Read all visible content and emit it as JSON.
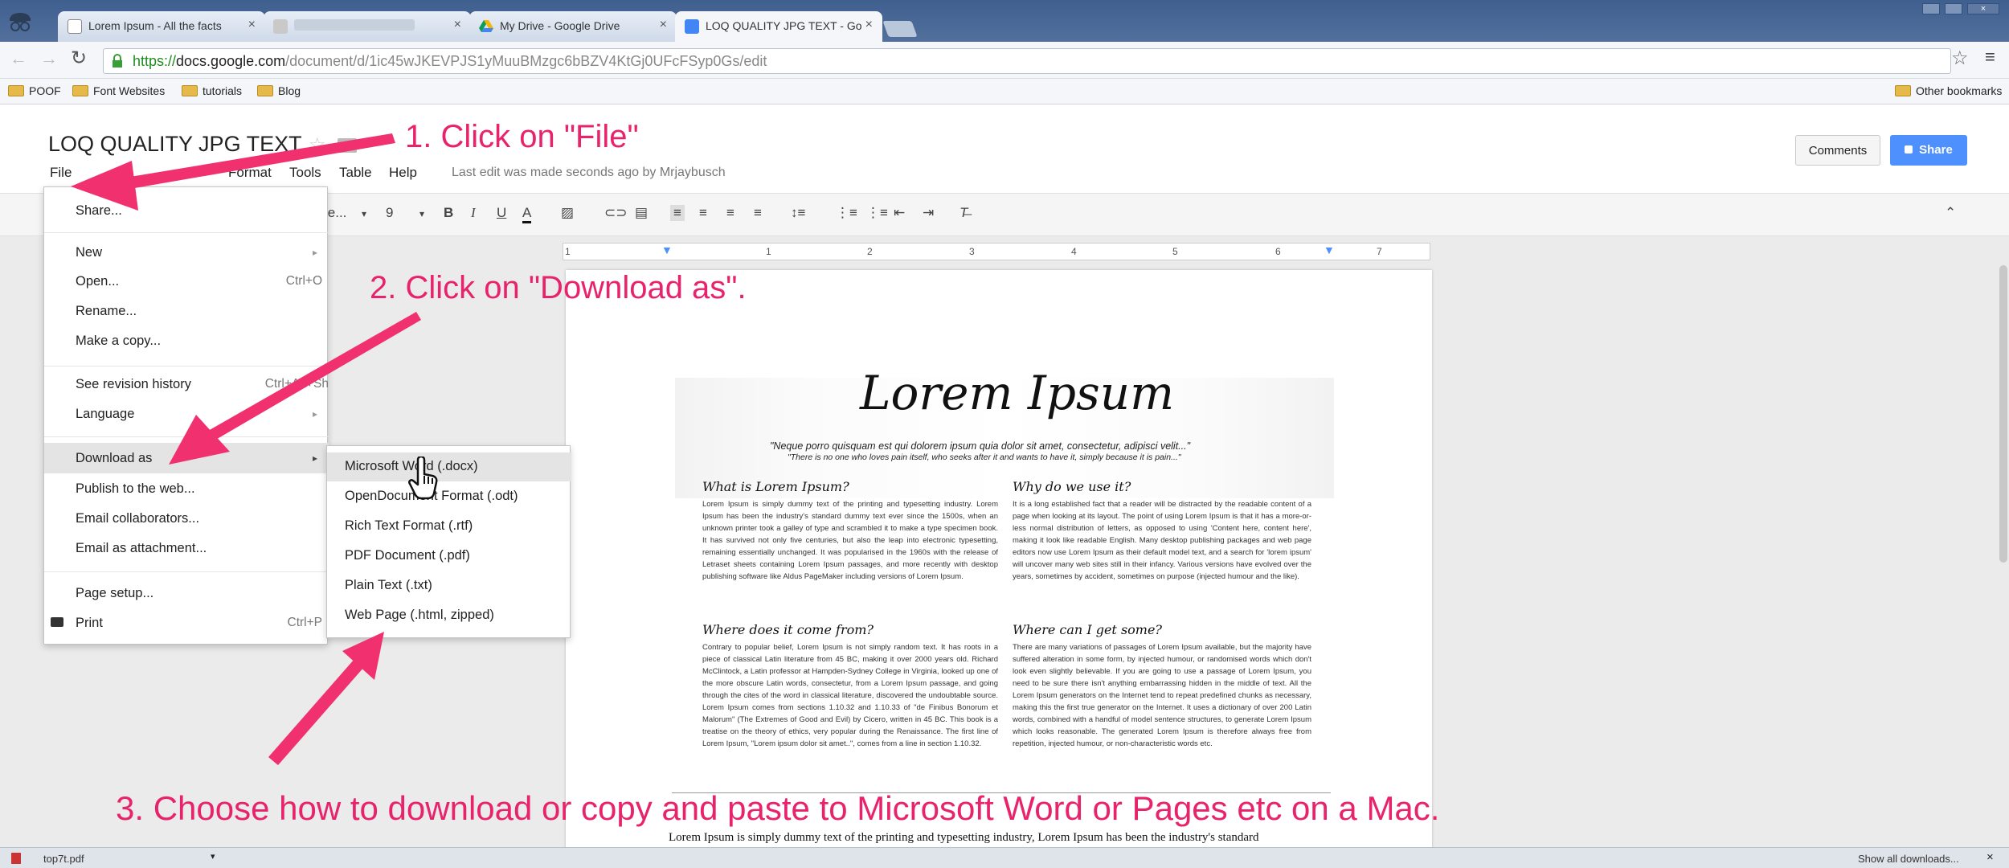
{
  "browser": {
    "tabs": [
      {
        "title": "Lorem Ipsum - All the facts",
        "favicon_color": "#ffffff"
      },
      {
        "title": "",
        "favicon_color": "#d9d9d9"
      },
      {
        "title": "My Drive - Google Drive",
        "favicon_color": "#f4b400"
      },
      {
        "title": "LOQ QUALITY JPG TEXT - Go",
        "favicon_color": "#4285f4"
      }
    ],
    "url_secure": "https://",
    "url_host": "docs.google.com",
    "url_path": "/document/d/1ic45wJKEVPJS1yMuuBMzgc6bBZV4KtGj0UFcFSyp0Gs/edit",
    "bookmarks": [
      "POOF",
      "Font Websites",
      "tutorials",
      "Blog"
    ],
    "other_bookmarks": "Other bookmarks"
  },
  "doc": {
    "title": "LOQ QUALITY JPG TEXT",
    "menus": [
      "File",
      "Format",
      "Tools",
      "Table",
      "Help"
    ],
    "last_edit": "Last edit was made seconds ago by Mrjaybusch",
    "comments": "Comments",
    "share": "Share",
    "font_size": "9",
    "style_fragment": "le...",
    "ruler_numbers": [
      "1",
      "1",
      "2",
      "3",
      "4",
      "5",
      "6",
      "7"
    ]
  },
  "file_menu": {
    "items": [
      {
        "label": "Share..."
      },
      {
        "label": "New",
        "submenu": true
      },
      {
        "label": "Open...",
        "shortcut": "Ctrl+O"
      },
      {
        "label": "Rename..."
      },
      {
        "label": "Make a copy..."
      },
      {
        "label": "See revision history",
        "shortcut": "Ctrl+Alt+Sh"
      },
      {
        "label": "Language",
        "submenu": true
      },
      {
        "label": "Download as",
        "submenu": true
      },
      {
        "label": "Publish to the web..."
      },
      {
        "label": "Email collaborators..."
      },
      {
        "label": "Email as attachment..."
      },
      {
        "label": "Page setup..."
      },
      {
        "label": "Print",
        "shortcut": "Ctrl+P"
      }
    ]
  },
  "download_submenu": {
    "items": [
      "Microsoft Word (.docx)",
      "OpenDocument Format (.odt)",
      "Rich Text Format (.rtf)",
      "PDF Document (.pdf)",
      "Plain Text (.txt)",
      "Web Page (.html, zipped)"
    ]
  },
  "lorem_image": {
    "title": "Lorem Ipsum",
    "quote1": "\"Neque porro quisquam est qui dolorem ipsum quia dolor sit amet, consectetur, adipisci velit...\"",
    "quote2": "\"There is no one who loves pain itself, who seeks after it and wants to have it, simply because it is pain...\"",
    "sections": [
      {
        "heading": "What is Lorem Ipsum?",
        "body": "Lorem Ipsum is simply dummy text of the printing and typesetting industry. Lorem Ipsum has been the industry's standard dummy text ever since the 1500s, when an unknown printer took a galley of type and scrambled it to make a type specimen book. It has survived not only five centuries, but also the leap into electronic typesetting, remaining essentially unchanged. It was popularised in the 1960s with the release of Letraset sheets containing Lorem Ipsum passages, and more recently with desktop publishing software like Aldus PageMaker including versions of Lorem Ipsum."
      },
      {
        "heading": "Why do we use it?",
        "body": "It is a long established fact that a reader will be distracted by the readable content of a page when looking at its layout. The point of using Lorem Ipsum is that it has a more-or-less normal distribution of letters, as opposed to using 'Content here, content here', making it look like readable English. Many desktop publishing packages and web page editors now use Lorem Ipsum as their default model text, and a search for 'lorem ipsum' will uncover many web sites still in their infancy. Various versions have evolved over the years, sometimes by accident, sometimes on purpose (injected humour and the like)."
      },
      {
        "heading": "Where does it come from?",
        "body": "Contrary to popular belief, Lorem Ipsum is not simply random text. It has roots in a piece of classical Latin literature from 45 BC, making it over 2000 years old. Richard McClintock, a Latin professor at Hampden-Sydney College in Virginia, looked up one of the more obscure Latin words, consectetur, from a Lorem Ipsum passage, and going through the cites of the word in classical literature, discovered the undoubtable source. Lorem Ipsum comes from sections 1.10.32 and 1.10.33 of \"de Finibus Bonorum et Malorum\" (The Extremes of Good and Evil) by Cicero, written in 45 BC. This book is a treatise on the theory of ethics, very popular during the Renaissance. The first line of Lorem Ipsum, \"Lorem ipsum dolor sit amet..\", comes from a line in section 1.10.32."
      },
      {
        "heading": "Where can I get some?",
        "body": "There are many variations of passages of Lorem Ipsum available, but the majority have suffered alteration in some form, by injected humour, or randomised words which don't look even slightly believable. If you are going to use a passage of Lorem Ipsum, you need to be sure there isn't anything embarrassing hidden in the middle of text. All the Lorem Ipsum generators on the Internet tend to repeat predefined chunks as necessary, making this the first true generator on the Internet. It uses a dictionary of over 200 Latin words, combined with a handful of model sentence structures, to generate Lorem Ipsum which looks reasonable. The generated Lorem Ipsum is therefore always free from repetition, injected humour, or non-characteristic words etc."
      }
    ],
    "bottom_text": "Lorem Ipsum is simply dummy text of the printing and typesetting industry, Lorem Ipsum has been the industry's standard"
  },
  "annotations": {
    "step1": "1. Click on \"File\"",
    "step2": "2. Click on \"Download as\".",
    "step3": "3. Choose how to download or copy and paste to Microsoft Word or Pages etc on a Mac."
  },
  "download_bar": {
    "file": "top7t.pdf",
    "show_all": "Show all downloads..."
  },
  "colors": {
    "annotation": "#e8236b",
    "share_button": "#4d90fe",
    "menu_highlight": "#e4e4e4"
  }
}
